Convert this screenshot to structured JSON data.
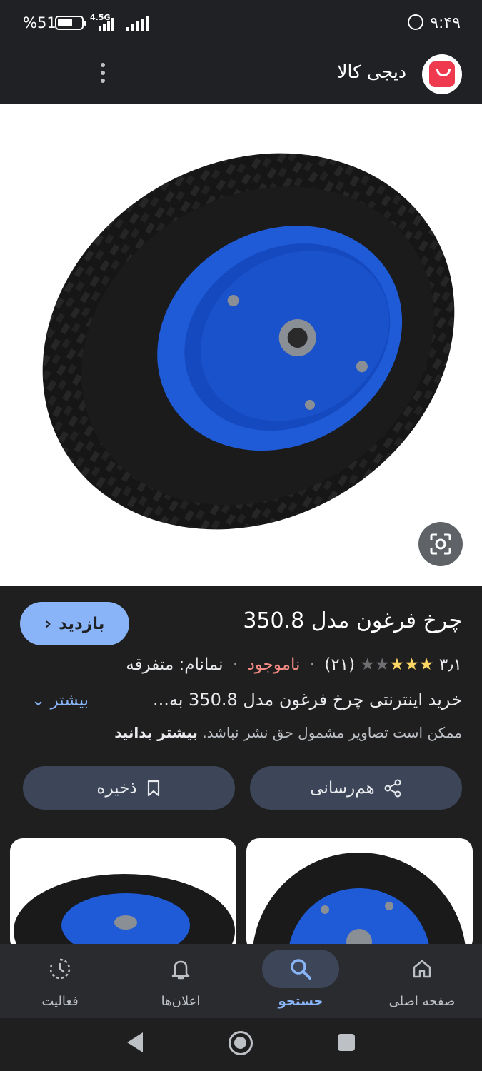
{
  "status_bar": {
    "time": "۹:۴۹",
    "battery_percent": "%51",
    "network": "4.5G"
  },
  "app_header": {
    "site_name": "دیجی کالا",
    "menu_icon": "more-vert-icon",
    "logo_color": "#ef394e"
  },
  "product": {
    "title": "چرخ فرغون مدل 350.8",
    "visit_label": "بازدید",
    "rating": "۳٫۱",
    "stars_filled": 3,
    "stars_total": 5,
    "review_count": "(۲۱)",
    "stock_status": "ناموجود",
    "brand": "نمانام: متفرقه",
    "description": "خرید اینترنتی چرخ فرغون مدل 350.8 به...",
    "more_label": "بیشتر",
    "copyright_notice": "ممکن است تصاویر مشمول حق نشر نباشد.",
    "copyright_link": "بیشتر بدانید"
  },
  "actions": {
    "share_label": "هم‌رسانی",
    "save_label": "ذخیره"
  },
  "bottom_nav": {
    "items": [
      {
        "label": "صفحه اصلی",
        "icon": "home-icon"
      },
      {
        "label": "جستجو",
        "icon": "search-icon"
      },
      {
        "label": "اعلان‌ها",
        "icon": "bell-icon"
      },
      {
        "label": "فعالیت",
        "icon": "activity-icon"
      }
    ],
    "active_index": 1
  },
  "colors": {
    "accent": "#8ab4f8",
    "out_of_stock": "#f28b82",
    "star": "#fdd663",
    "wheel_rim": "#1f5bd6"
  }
}
